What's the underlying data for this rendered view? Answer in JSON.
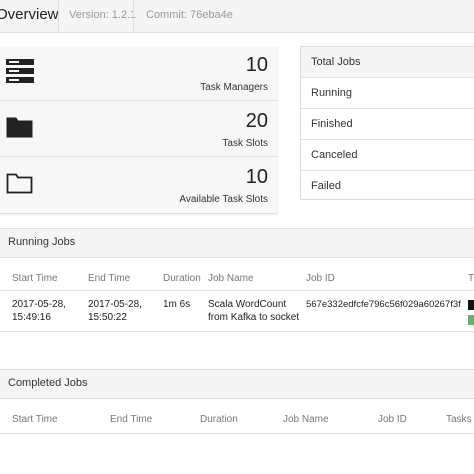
{
  "topbar": {
    "title": "Overview",
    "version": "Version: 1.2.1",
    "commit": "Commit: 76eba4e"
  },
  "cards": [
    {
      "value": "10",
      "label": "Task Managers",
      "icon": "server-icon"
    },
    {
      "value": "20",
      "label": "Task Slots",
      "icon": "folder-filled-icon"
    },
    {
      "value": "10",
      "label": "Available Task Slots",
      "icon": "folder-outline-icon"
    }
  ],
  "total_jobs": {
    "header": "Total Jobs",
    "rows": [
      "Running",
      "Finished",
      "Canceled",
      "Failed"
    ]
  },
  "running_jobs": {
    "title": "Running Jobs",
    "columns": [
      "Start Time",
      "End Time",
      "Duration",
      "Job Name",
      "Job ID",
      "T"
    ],
    "rows": [
      {
        "start": "2017-05-28, 15:49:16",
        "end": "2017-05-28, 15:50:22",
        "duration": "1m 6s",
        "name": "Scala WordCount from Kafka to socket",
        "id": "567e332edfcfe796c56f029a60267f3f"
      }
    ]
  },
  "completed_jobs": {
    "title": "Completed Jobs",
    "columns": [
      "Start Time",
      "End Time",
      "Duration",
      "Job Name",
      "Job ID",
      "Tasks"
    ]
  }
}
